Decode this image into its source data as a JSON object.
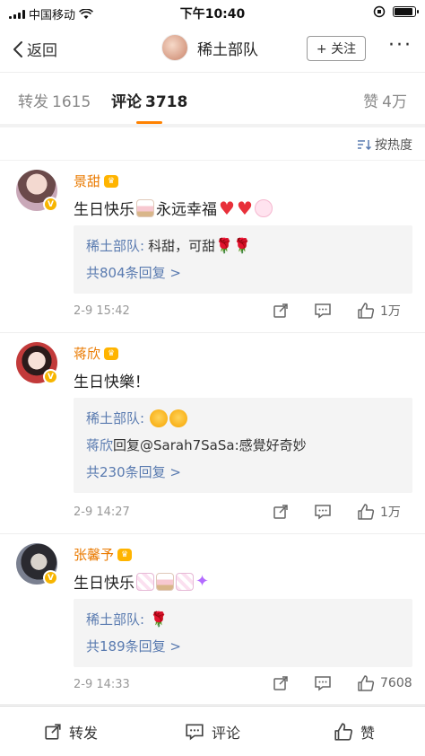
{
  "status_bar": {
    "carrier": "中国移动",
    "time": "下午10:40"
  },
  "nav": {
    "back_label": "返回",
    "title": "稀土部队",
    "follow_label": "+ 关注",
    "more_label": "···"
  },
  "tabs": [
    {
      "label": "转发",
      "count": "1615"
    },
    {
      "label": "评论",
      "count": "3718"
    },
    {
      "label": "赞",
      "count": "4万"
    }
  ],
  "sort_label": "按热度",
  "comments": [
    {
      "name": "景甜",
      "text": "生日快乐",
      "text2": "永远幸福",
      "reply_author": "稀土部队:",
      "reply_text": "科甜，可甜",
      "reply_more": "共804条回复 >",
      "time": "2-9 15:42",
      "likes": "1万",
      "avatar_color": "#c9a8b8"
    },
    {
      "name": "蒋欣",
      "text": "生日快樂！",
      "reply_author": "稀土部队:",
      "reply2_author": "蒋欣",
      "reply2_text": "回复@Sarah7SaSa:感覺好奇妙",
      "reply_more": "共230条回复 >",
      "time": "2-9 14:27",
      "likes": "1万",
      "avatar_color": "#c23a3a"
    },
    {
      "name": "张馨予",
      "text": "生日快乐",
      "reply_author": "稀土部队:",
      "reply_more": "共189条回复 >",
      "time": "2-9 14:33",
      "likes": "7608",
      "avatar_color": "#5a5f70"
    }
  ],
  "bottom_bar": {
    "repost": "转发",
    "comment": "评论",
    "like": "赞"
  },
  "colors": {
    "accent": "#ff8200",
    "name": "#ea7a00",
    "link": "#5a7bb0"
  }
}
